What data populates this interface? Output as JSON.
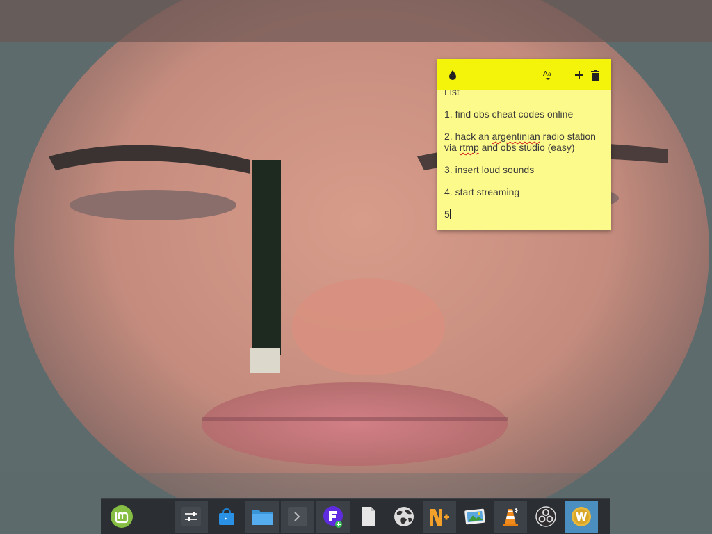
{
  "desktop": {
    "wallpaper": "pixelated close-up face photo"
  },
  "sticky_note": {
    "colors": {
      "header": "#f4f40a",
      "body": "#fdfa8c",
      "text": "#3a3a3a",
      "spellcheck": "#d21d1d"
    },
    "header_icons": [
      "color-drop-icon",
      "text-format-icon",
      "plus-icon",
      "trash-icon"
    ],
    "title_partial": "List",
    "items": [
      "1. find obs cheat codes online",
      "2. hack an argentinian radio station via rtmp and obs studio (easy)",
      "3. insert loud sounds",
      "4. start streaming",
      "5"
    ],
    "item2": {
      "part1": "2. hack an ",
      "misspelled1": "argentinian",
      "part2": " radio station",
      "part3": "via ",
      "misspelled2": "rtmp",
      "part4": " and obs studio (easy)"
    }
  },
  "panel": {
    "background": "#2b2f33",
    "items": [
      {
        "name": "mint-menu",
        "icon": "linux-mint-logo-icon"
      },
      {
        "name": "system-settings",
        "icon": "sliders-icon"
      },
      {
        "name": "software-manager",
        "icon": "shopping-bag-icon"
      },
      {
        "name": "file-manager",
        "icon": "folder-icon"
      },
      {
        "name": "terminal",
        "icon": "terminal-icon"
      },
      {
        "name": "app-f",
        "icon": "f-letter-icon"
      },
      {
        "name": "text-document",
        "icon": "document-icon"
      },
      {
        "name": "web-browser",
        "icon": "globe-icon"
      },
      {
        "name": "notes-app",
        "icon": "n-plus-icon"
      },
      {
        "name": "image-viewer",
        "icon": "picture-icon"
      },
      {
        "name": "vlc",
        "icon": "traffic-cone-icon"
      },
      {
        "name": "obs-studio",
        "icon": "obs-icon"
      },
      {
        "name": "w-app",
        "icon": "w-coin-icon"
      }
    ]
  }
}
